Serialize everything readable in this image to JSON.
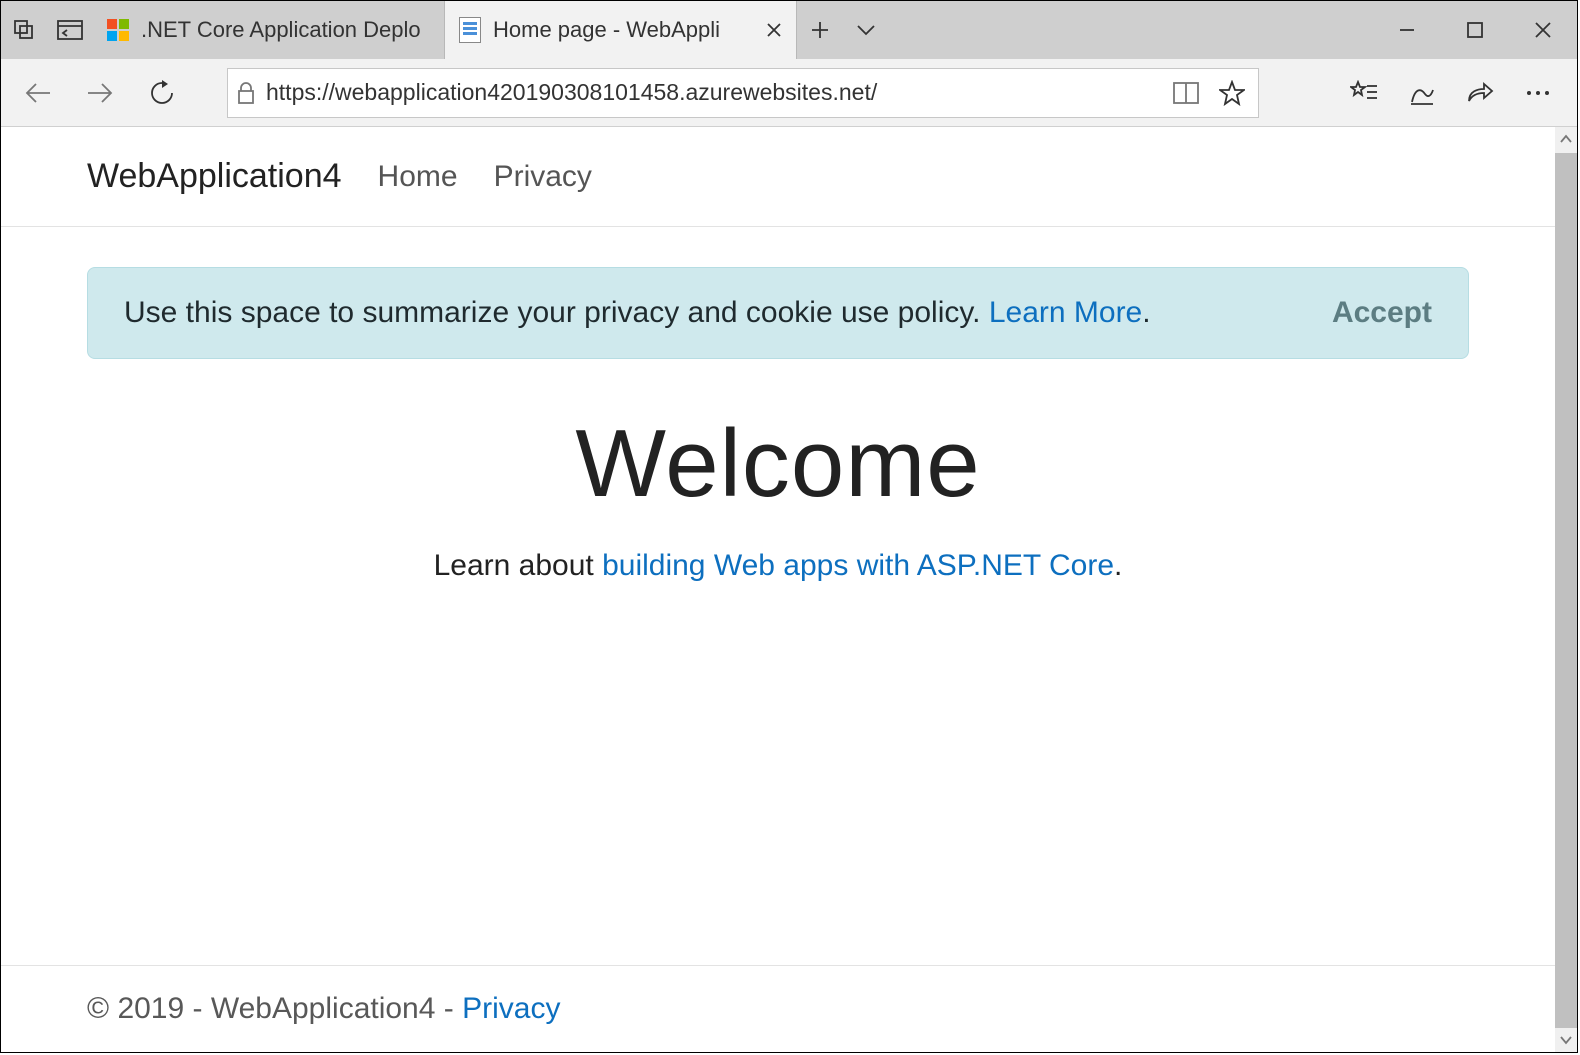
{
  "browser": {
    "tabs": [
      {
        "title": ".NET Core Application Deplo"
      },
      {
        "title": "Home page - WebAppli"
      }
    ],
    "url": "https://webapplication420190308101458.azurewebsites.net/"
  },
  "site": {
    "brand": "WebApplication4",
    "nav": {
      "home": "Home",
      "privacy": "Privacy"
    }
  },
  "banner": {
    "text": "Use this space to summarize your privacy and cookie use policy. ",
    "learn_more": "Learn More",
    "period": ".",
    "accept": "Accept"
  },
  "hero": {
    "title": "Welcome",
    "lead_prefix": "Learn about ",
    "lead_link": "building Web apps with ASP.NET Core",
    "lead_suffix": "."
  },
  "footer": {
    "text_prefix": "© 2019 - WebApplication4 - ",
    "privacy": "Privacy"
  }
}
